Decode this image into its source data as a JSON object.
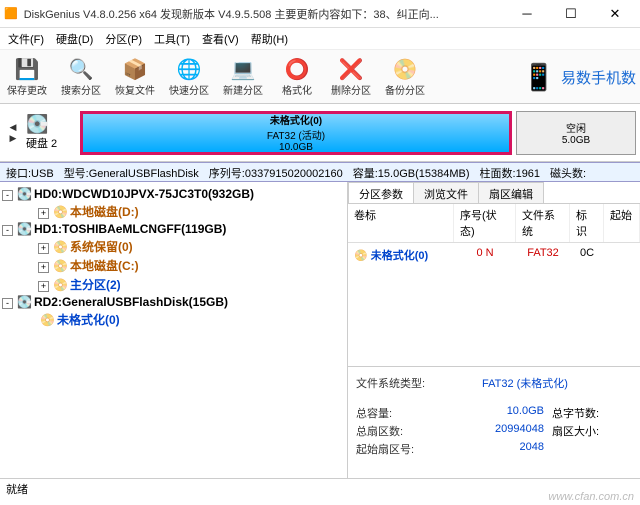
{
  "title": "DiskGenius V4.8.0.256 x64   发现新版本 V4.9.5.508 主要更新内容如下：38、纠正向...",
  "menu": [
    "文件(F)",
    "硬盘(D)",
    "分区(P)",
    "工具(T)",
    "查看(V)",
    "帮助(H)"
  ],
  "toolbar": [
    {
      "label": "保存更改",
      "icon": "💾"
    },
    {
      "label": "搜索分区",
      "icon": "🔍"
    },
    {
      "label": "恢复文件",
      "icon": "📦"
    },
    {
      "label": "快速分区",
      "icon": "🌐"
    },
    {
      "label": "新建分区",
      "icon": "💻"
    },
    {
      "label": "格式化",
      "icon": "⭕"
    },
    {
      "label": "删除分区",
      "icon": "❌"
    },
    {
      "label": "备份分区",
      "icon": "📀"
    }
  ],
  "promo": "易数手机数",
  "diskLabel": "硬盘 2",
  "partMain": {
    "l1": "未格式化(0)",
    "l2": "FAT32 (活动)",
    "l3": "10.0GB"
  },
  "partFree": {
    "l1": "空闲",
    "l2": "5.0GB"
  },
  "infobar": {
    "iface": "接口:USB",
    "model": "型号:GeneralUSBFlashDisk",
    "serial": "序列号:0337915020002160",
    "cap": "容量:15.0GB(15384MB)",
    "cyl": "柱面数:1961",
    "heads": "磁头数:"
  },
  "tree": {
    "hd0": "HD0:WDCWD10JPVX-75JC3T0(932GB)",
    "hd0c": "本地磁盘(D:)",
    "hd1": "HD1:TOSHIBAeMLCNGFF(119GB)",
    "hd1a": "系统保留(0)",
    "hd1b": "本地磁盘(C:)",
    "hd1c": "主分区(2)",
    "rd2": "RD2:GeneralUSBFlashDisk(15GB)",
    "rd2a": "未格式化(0)"
  },
  "tabs": [
    "分区参数",
    "浏览文件",
    "扇区编辑"
  ],
  "cols": {
    "c0": "卷标",
    "c1": "序号(状态)",
    "c2": "文件系统",
    "c3": "标识",
    "c4": "起始"
  },
  "row": {
    "name": "未格式化(0)",
    "seq": "0 N",
    "fs": "FAT32",
    "flag": "0C"
  },
  "fs": {
    "typeK": "文件系统类型:",
    "typeV": "FAT32 (未格式化)",
    "totK": "总容量:",
    "totV": "10.0GB",
    "bytesK": "总字节数:",
    "secK": "总扇区数:",
    "secV": "20994048",
    "clusK": "扇区大小:",
    "startK": "起始扇区号:",
    "startV": "2048"
  },
  "status": "就绪",
  "watermark": "www.cfan.com.cn"
}
